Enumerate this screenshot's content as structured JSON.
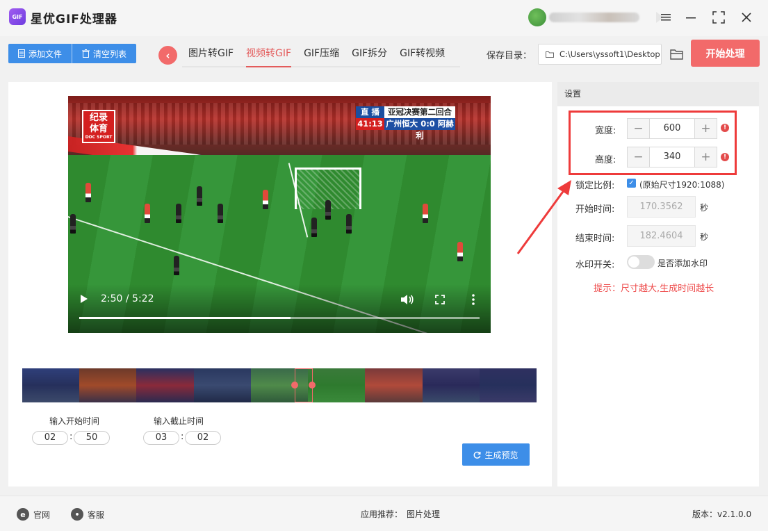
{
  "app": {
    "title": "星优GIF处理器",
    "logo_text": "GIF"
  },
  "toolbar": {
    "add_files": "添加文件",
    "clear_list": "清空列表",
    "save_dir_label": "保存目录：",
    "save_dir_path": "C:\\Users\\yssoft1\\Desktop",
    "start": "开始处理"
  },
  "tabs": [
    {
      "label": "图片转GIF",
      "active": false
    },
    {
      "label": "视频转GIF",
      "active": true
    },
    {
      "label": "GIF压缩",
      "active": false
    },
    {
      "label": "GIF拆分",
      "active": false
    },
    {
      "label": "GIF转视频",
      "active": false
    }
  ],
  "video": {
    "current_time": "2:50",
    "duration": "5:22",
    "time_display": "2:50 / 5:22",
    "progress": 0.528,
    "badge_line1": "纪录",
    "badge_line2": "体育",
    "badge_sub": "DOC SPORT",
    "score_live": "直 播",
    "score_title": "亚冠决赛第二回合",
    "score_time": "41:13",
    "score_teams": "广州恒大 0:0 阿赫利"
  },
  "trim": {
    "start_label": "输入开始时间",
    "end_label": "输入截止时间",
    "start_min": "02",
    "start_sec": "50",
    "end_min": "03",
    "end_sec": "02",
    "preview_button": "生成预览"
  },
  "settings": {
    "header": "设置",
    "width_label": "宽度:",
    "width_value": "600",
    "height_label": "高度:",
    "height_value": "340",
    "lock_label": "锁定比例:",
    "lock_checked": true,
    "original_size": "(原始尺寸1920:1088)",
    "start_time_label": "开始时间:",
    "start_time_value": "170.3562",
    "end_time_label": "结束时间:",
    "end_time_value": "182.4604",
    "seconds_unit": "秒",
    "watermark_label": "水印开关:",
    "watermark_desc": "是否添加水印",
    "tip": "提示：尺寸越大,生成时间越长"
  },
  "footer": {
    "website": "官网",
    "support": "客服",
    "recommend_label": "应用推荐：",
    "recommend_app": "图片处理",
    "version_label": "版本：",
    "version": "v2.1.0.0"
  },
  "colors": {
    "accent_red": "#f26a6a",
    "accent_blue": "#3d8ee8",
    "highlight": "#ee3b3b"
  }
}
